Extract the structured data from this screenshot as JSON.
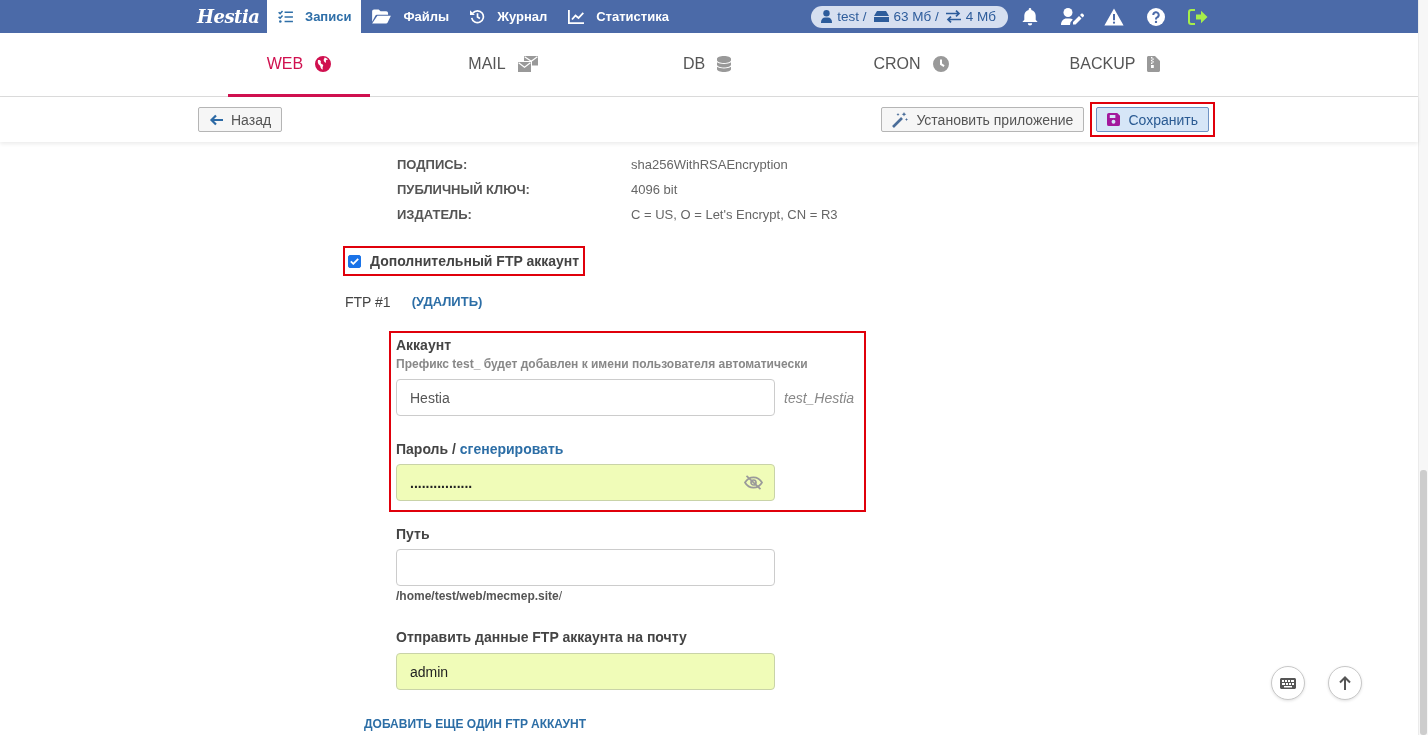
{
  "topbar": {
    "logo": "Hestia",
    "nav": [
      {
        "kind": "records",
        "label": "Записи",
        "selected": true
      },
      {
        "kind": "files",
        "label": "Файлы",
        "selected": false
      },
      {
        "kind": "log",
        "label": "Журнал",
        "selected": false
      },
      {
        "kind": "stats",
        "label": "Статистика",
        "selected": false
      }
    ],
    "usage": [
      {
        "kind": "user",
        "text": "test /"
      },
      {
        "kind": "disk",
        "text": "63 Мб /"
      },
      {
        "kind": "traffic",
        "text": "4 Мб"
      }
    ]
  },
  "tabs": [
    {
      "kind": "web",
      "label": "WEB",
      "selected": true
    },
    {
      "kind": "mail",
      "label": "MAIL",
      "selected": false
    },
    {
      "kind": "db",
      "label": "DB",
      "selected": false
    },
    {
      "kind": "cron",
      "label": "CRON",
      "selected": false
    },
    {
      "kind": "backup",
      "label": "BACKUP",
      "selected": false
    }
  ],
  "toolbar": {
    "back": "Назад",
    "actions": [
      {
        "kind": "install",
        "label": "Установить приложение",
        "highlighted": false
      },
      {
        "kind": "save",
        "label": "Сохранить",
        "highlighted": true
      }
    ]
  },
  "certificate": [
    {
      "label": "ПОДПИСЬ:",
      "value": "sha256WithRSAEncryption"
    },
    {
      "label": "ПУБЛИЧНЫЙ КЛЮЧ:",
      "value": "4096 bit"
    },
    {
      "label": "ИЗДАТЕЛЬ:",
      "value": "C = US, O = Let's Encrypt, CN = R3"
    }
  ],
  "ftp_option": {
    "label": "Дополнительный FTP аккаунт",
    "checked": true,
    "highlighted": true
  },
  "ftp_accounts": [
    {
      "title": "FTP #1",
      "remove": "(УДАЛИТЬ)",
      "highlighted": true,
      "account": {
        "label": "Аккаунт",
        "hint": "Префикс test_ будет добавлен к имени пользователя автоматически",
        "value": "Hestia",
        "preview": "test_Hestia",
        "autofilled": false
      },
      "password": {
        "label": "Пароль /",
        "generate": "сгенерировать",
        "value": "................",
        "autofilled": true
      },
      "path": {
        "label": "Путь",
        "hint": "**/home/test/web/mecmep.site**/",
        "autofilled": false
      },
      "notify": {
        "label": "Отправить данные FTP аккаунта на почту",
        "value": "admin",
        "autofilled": true
      }
    }
  ],
  "add_ftp": "ДОБАВИТЬ ЕЩЕ ОДИН FTP АККАУНТ"
}
